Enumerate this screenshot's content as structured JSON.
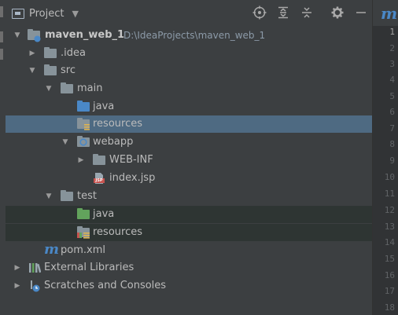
{
  "header": {
    "title": "Project",
    "icons": [
      "crosshair-icon",
      "expand-all-icon",
      "collapse-all-icon",
      "gear-icon",
      "minimize-icon"
    ]
  },
  "tree": [
    {
      "label": "maven_web_1",
      "path": "D:\\IdeaProjects\\maven_web_1",
      "icon": "module-folder-icon",
      "expanded": true
    },
    {
      "label": ".idea",
      "icon": "folder-icon"
    },
    {
      "label": "src",
      "icon": "folder-icon",
      "expanded": true
    },
    {
      "label": "main",
      "icon": "folder-icon",
      "expanded": true
    },
    {
      "label": "java",
      "icon": "source-folder-icon"
    },
    {
      "label": "resources",
      "icon": "resources-folder-icon",
      "selected": true
    },
    {
      "label": "webapp",
      "icon": "web-folder-icon",
      "expanded": true
    },
    {
      "label": "WEB-INF",
      "icon": "folder-icon"
    },
    {
      "label": "index.jsp",
      "icon": "jsp-file-icon",
      "badge": "JSP"
    },
    {
      "label": "test",
      "icon": "folder-icon",
      "expanded": true
    },
    {
      "label": "java",
      "icon": "test-source-folder-icon"
    },
    {
      "label": "resources",
      "icon": "test-resources-folder-icon"
    },
    {
      "label": "pom.xml",
      "icon": "maven-icon",
      "glyph": "m"
    },
    {
      "label": "External Libraries",
      "icon": "libraries-icon"
    },
    {
      "label": "Scratches and Consoles",
      "icon": "scratches-icon"
    }
  ],
  "editor": {
    "logo": "m",
    "line_numbers": [
      "1",
      "2",
      "3",
      "4",
      "5",
      "6",
      "7",
      "8",
      "9",
      "10",
      "11",
      "12",
      "13",
      "14",
      "15",
      "16",
      "17",
      "18"
    ]
  },
  "colors": {
    "selection": "#4e6a82",
    "test_tint": "#2e3533",
    "source_folder": "#4a88c7",
    "test_folder": "#62a35c",
    "plain_folder": "#87939a"
  }
}
